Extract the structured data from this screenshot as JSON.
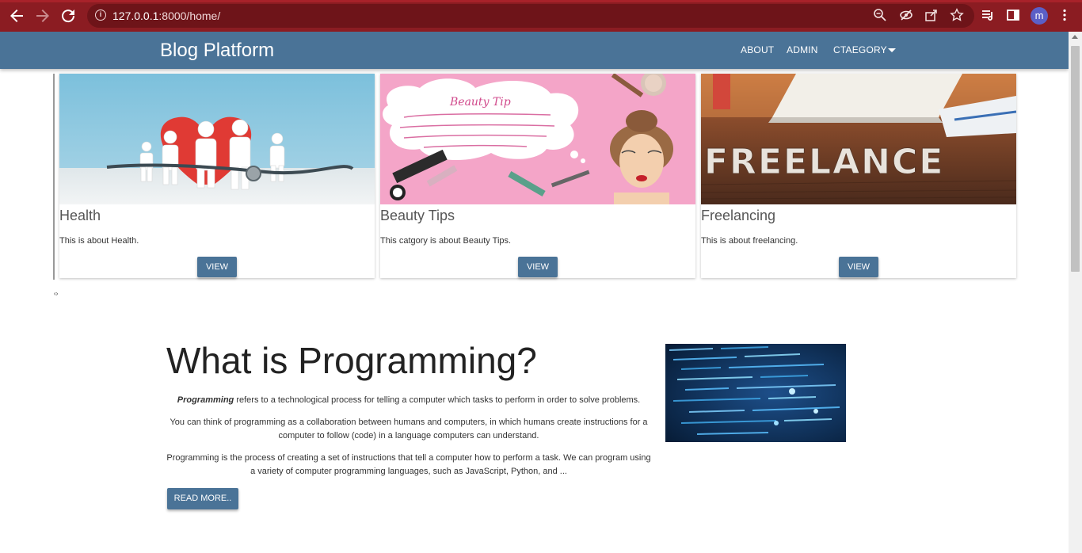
{
  "browser": {
    "url_host": "127.0.0.1",
    "url_rest": ":8000/home/",
    "avatar_letter": "m",
    "icons": [
      "back-icon",
      "forward-icon",
      "reload-icon",
      "info-icon",
      "zoom-icon",
      "tracking-off-icon",
      "share-icon",
      "star-icon",
      "reading-list-icon",
      "side-panel-icon",
      "menu-icon"
    ]
  },
  "navbar": {
    "brand": "Blog Platform",
    "links": [
      "ABOUT",
      "ADMIN",
      "CTAEGORY"
    ],
    "color": "#4a7397"
  },
  "categories": [
    {
      "title": "Health",
      "description": "This is about Health.",
      "button": "VIEW"
    },
    {
      "title": "Beauty Tips",
      "description": "This catgory is about Beauty Tips.",
      "button": "VIEW"
    },
    {
      "title": "Freelancing",
      "description": "This is about freelancing.",
      "button": "VIEW"
    }
  ],
  "images": {
    "beauty_heading": "Beauty Tip",
    "freelance_word": "FREELANCE"
  },
  "carousel_indicator": "‹›",
  "article": {
    "title": "What is Programming?",
    "p1_em": "Programming",
    "p1_rest": " refers to a technological process for telling a computer which tasks to perform in order to solve problems.",
    "p2": "You can think of programming as a collaboration between humans and computers, in which humans create instructions for a computer to follow (code) in a language computers can understand.",
    "p3": "Programming is the process of creating a set of instructions that tell a computer how to perform a task. We can program using a variety of computer programming languages, such as JavaScript, Python, and ...",
    "read_more": "READ MORE.."
  }
}
